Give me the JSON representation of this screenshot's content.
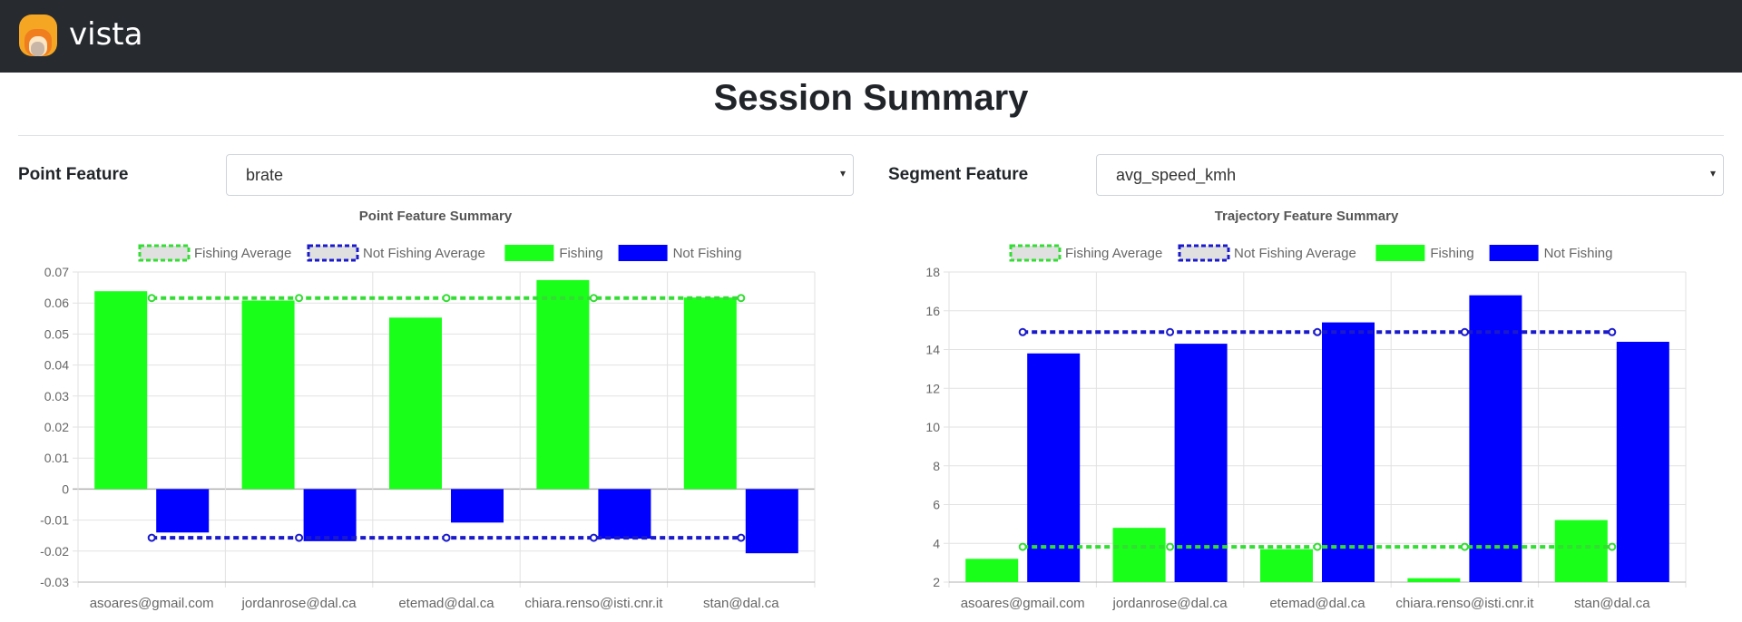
{
  "app": {
    "logo_text": "vista"
  },
  "page": {
    "title": "Session Summary"
  },
  "controls": {
    "point_feature": {
      "label": "Point Feature",
      "value": "brate",
      "caret": "▾"
    },
    "segment_feature": {
      "label": "Segment Feature",
      "value": "avg_speed_kmh",
      "caret": "▾"
    }
  },
  "colors": {
    "header_bg": "#272b30",
    "fishing": "#1aff1a",
    "not_fishing": "#0000ff",
    "fishing_avg_line": "#33dd33",
    "not_fishing_avg_line": "#1a1acc"
  },
  "chart_data": [
    {
      "type": "bar",
      "title": "Point Feature Summary",
      "categories": [
        "asoares@gmail.com",
        "jordanrose@dal.ca",
        "etemad@dal.ca",
        "chiara.renso@isti.cnr.it",
        "stan@dal.ca"
      ],
      "series": [
        {
          "name": "Fishing",
          "values": [
            0.0638,
            0.0608,
            0.0553,
            0.0674,
            0.0618
          ]
        },
        {
          "name": "Not Fishing",
          "values": [
            -0.014,
            -0.0168,
            -0.0108,
            -0.016,
            -0.0207
          ]
        }
      ],
      "lines": [
        {
          "name": "Fishing Average",
          "value": 0.0616
        },
        {
          "name": "Not Fishing Average",
          "value": -0.0157
        }
      ],
      "legend": [
        "Fishing Average",
        "Not Fishing Average",
        "Fishing",
        "Not Fishing"
      ],
      "legend_position": "top",
      "ylim": [
        -0.03,
        0.07
      ],
      "yticks": [
        "0.07",
        "0.06",
        "0.05",
        "0.04",
        "0.03",
        "0.02",
        "0.01",
        "0",
        "-0.01",
        "-0.02",
        "-0.03"
      ],
      "grid": true
    },
    {
      "type": "bar",
      "title": "Trajectory Feature Summary",
      "categories": [
        "asoares@gmail.com",
        "jordanrose@dal.ca",
        "etemad@dal.ca",
        "chiara.renso@isti.cnr.it",
        "stan@dal.ca"
      ],
      "series": [
        {
          "name": "Fishing",
          "values": [
            3.2,
            4.8,
            3.7,
            2.2,
            5.2
          ]
        },
        {
          "name": "Not Fishing",
          "values": [
            13.8,
            14.3,
            15.4,
            16.8,
            14.4
          ]
        }
      ],
      "lines": [
        {
          "name": "Fishing Average",
          "value": 3.82
        },
        {
          "name": "Not Fishing Average",
          "value": 14.9
        }
      ],
      "legend": [
        "Fishing Average",
        "Not Fishing Average",
        "Fishing",
        "Not Fishing"
      ],
      "legend_position": "top",
      "ylim": [
        2,
        18
      ],
      "yticks": [
        "18",
        "16",
        "14",
        "12",
        "10",
        "8",
        "6",
        "4",
        "2"
      ],
      "grid": true
    }
  ]
}
